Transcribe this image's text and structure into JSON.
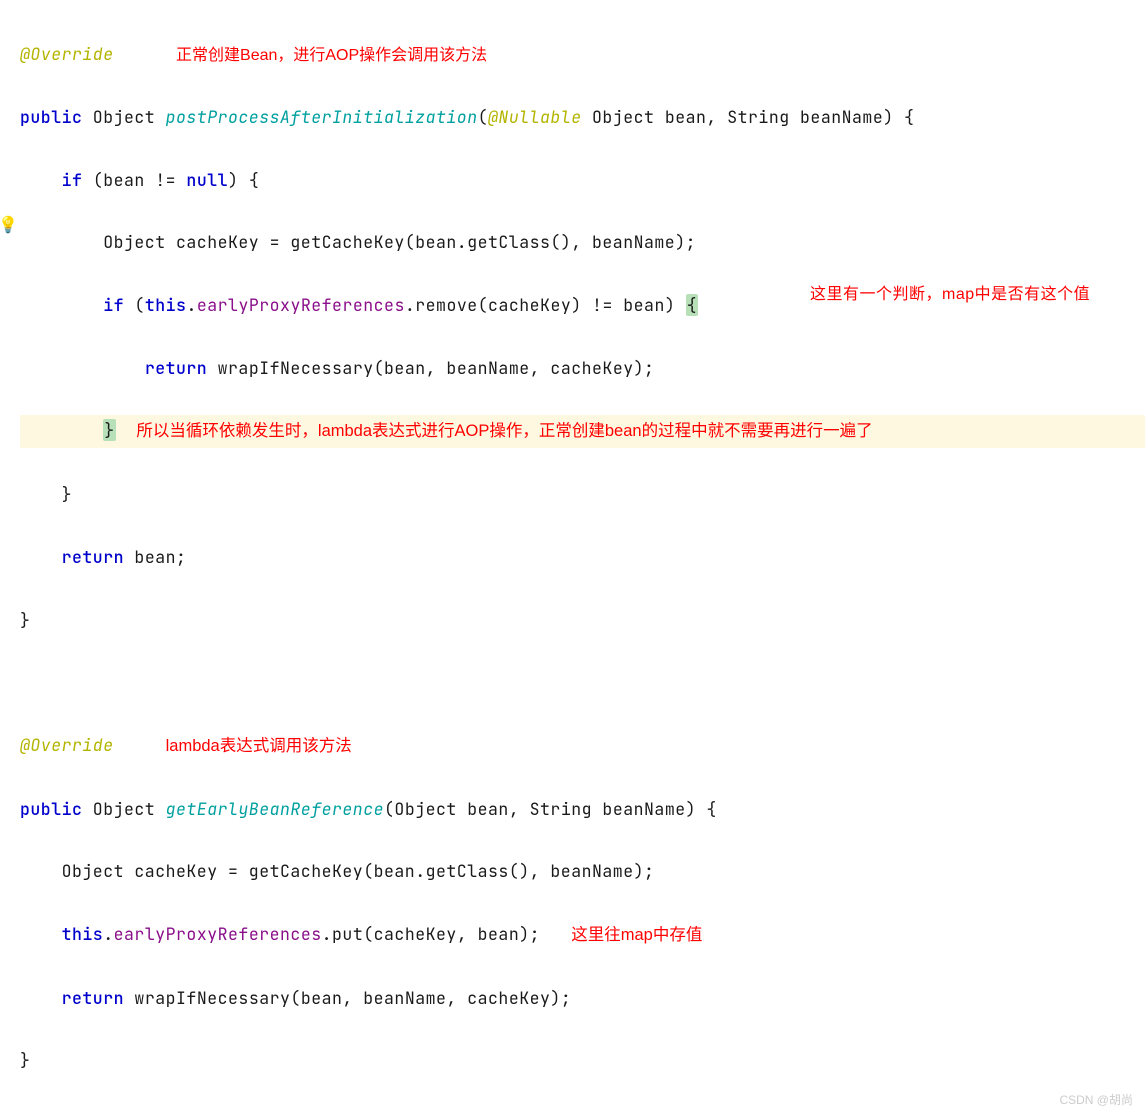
{
  "annotations": {
    "top1": "正常创建Bean，进行AOP操作会调用该方法",
    "right1": "这里有一个判断，map中是否有这个值",
    "middle1": "所以当循环依赖发生时，lambda表达式进行AOP操作，正常创建bean的过程中就不需要再进行一遍了",
    "mid2": "lambda表达式调用该方法",
    "right2": "这里往map中存值"
  },
  "code": {
    "override": "@Override",
    "kw_public": "public",
    "kw_if": "if",
    "kw_return": "return",
    "kw_null": "null",
    "kw_this": "this",
    "type_object": "Object",
    "type_string": "String",
    "nullable": "@Nullable",
    "m1_name": "postProcessAfterInitialization",
    "m1_sig_params": "Object bean, String beanName) {",
    "m1_if1": "if (bean != null) {",
    "m1_cacheKey": "Object cacheKey = getCacheKey(bean.getClass(), beanName);",
    "m1_if2a": "if (",
    "m1_if2b": ".",
    "m1_field": "earlyProxyReferences",
    "m1_if2c": ".remove(cacheKey) != bean) ",
    "m1_ret": "return wrapIfNecessary(bean, beanName, cacheKey);",
    "m1_close1": "}",
    "m1_close2": "}",
    "m1_retbean": "return bean;",
    "m1_close3": "}",
    "m2_name": "getEarlyBeanReference",
    "m2_sig": "(Object bean, String beanName) {",
    "m2_cacheKey": "Object cacheKey = getCacheKey(bean.getClass(), beanName);",
    "m2_put": ".put(cacheKey, bean);",
    "m2_ret": "return wrapIfNecessary(bean, beanName, cacheKey);",
    "m2_close": "}"
  },
  "watermark": "CSDN @胡尚"
}
